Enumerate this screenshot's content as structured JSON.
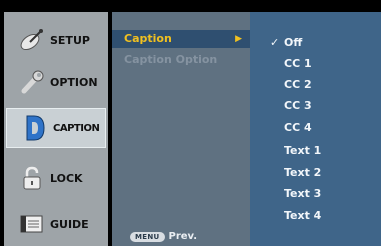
{
  "left_menu": {
    "items": [
      {
        "label": "SETUP",
        "icon": "satellite-dish-icon"
      },
      {
        "label": "OPTION",
        "icon": "wrench-icon"
      },
      {
        "label": "CAPTION",
        "icon": "caption-d-icon",
        "active": true
      },
      {
        "label": "LOCK",
        "icon": "padlock-icon"
      },
      {
        "label": "GUIDE",
        "icon": "guide-book-icon"
      }
    ]
  },
  "submenu": {
    "items": [
      {
        "label": "Caption",
        "selected": true
      },
      {
        "label": "Caption Option",
        "enabled": false
      }
    ],
    "prev_key": "MENU",
    "prev_label": "Prev."
  },
  "options": {
    "items": [
      "Off",
      "CC 1",
      "CC 2",
      "CC 3",
      "CC 4",
      "Text 1",
      "Text 2",
      "Text 3",
      "Text 4"
    ],
    "checked": "Off",
    "check_glyph": "✓"
  },
  "colors": {
    "selected_text": "#f0c020",
    "submenu_bg": "#5f7181",
    "options_bg": "#3f6589"
  }
}
